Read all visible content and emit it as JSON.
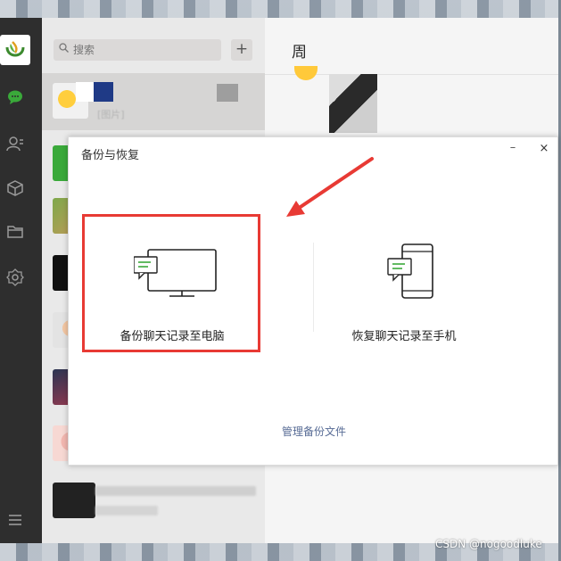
{
  "search": {
    "placeholder": "搜索"
  },
  "main": {
    "chat_title": "周"
  },
  "dialog": {
    "title": "备份与恢复",
    "minimize_glyph": "–",
    "close_glyph": "×",
    "option_backup_label": "备份聊天记录至电脑",
    "option_restore_label": "恢复聊天记录至手机",
    "manage_link": "管理备份文件"
  },
  "chat_list": {
    "first_item_tag": "[图片]"
  },
  "watermark": "CSDN @nogoodluke",
  "colors": {
    "highlight": "#e83a34",
    "wechat_green": "#3aa93a",
    "link": "#576b95"
  },
  "icons": [
    "search-icon",
    "add-icon",
    "chat-icon",
    "contacts-icon",
    "cube-icon",
    "folder-icon",
    "settings-icon",
    "menu-icon",
    "monitor-icon",
    "phone-icon",
    "message-bubble-icon"
  ]
}
